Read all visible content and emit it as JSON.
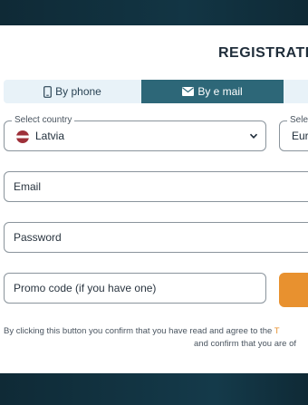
{
  "modal": {
    "title": "REGISTRATIC"
  },
  "tabs": [
    {
      "label": "By phone",
      "icon": "phone-icon",
      "active": false
    },
    {
      "label": "By e mail",
      "icon": "envelope-icon",
      "active": true
    }
  ],
  "form": {
    "country": {
      "label": "Select country",
      "value": "Latvia"
    },
    "currency": {
      "label": "Selec",
      "value": "Eur"
    },
    "email": {
      "placeholder": "Email",
      "value": ""
    },
    "password": {
      "placeholder": "Password",
      "value": ""
    },
    "promo": {
      "placeholder": "Promo code (if you have one)",
      "value": ""
    }
  },
  "terms": {
    "line1": "By clicking this button you confirm that you have read and agree to the ",
    "link": "T",
    "line2": "and confirm that you are of"
  },
  "colors": {
    "accent": "#e8912f",
    "active_tab": "#2d6778",
    "inactive_tab": "#e8f2f8",
    "background": "#0f2a36"
  }
}
